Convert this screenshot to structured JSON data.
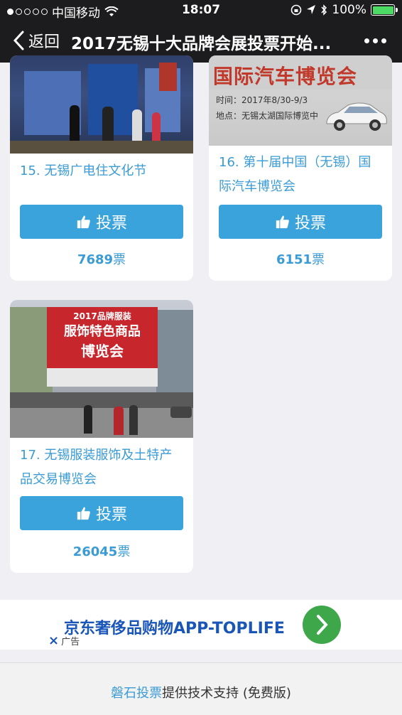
{
  "status": {
    "carrier": "中国移动",
    "time": "18:07",
    "battery": "100%",
    "battery_level": 1.0
  },
  "nav": {
    "back_label": "返回",
    "title": "2017无锡十大品牌会展投票开始..."
  },
  "cards": [
    {
      "name": "15. 无锡广电住文化节",
      "vote_label": "投票",
      "count": "7689",
      "unit": "票"
    },
    {
      "name": "16. 第十届中国（无锡）国际汽车博览会",
      "vote_label": "投票",
      "count": "6151",
      "unit": "票",
      "poster": {
        "headline": "国际汽车博览会",
        "line1": "时间：2017年8/30-9/3",
        "line2": "地点：无锡太湖国际博览中"
      }
    },
    {
      "name": "17. 无锡服装服饰及土特产品交易博览会",
      "vote_label": "投票",
      "count": "26045",
      "unit": "票",
      "banner": {
        "l1": "2017品牌服装",
        "l2": "服饰特色商品",
        "l3": "博览会"
      }
    }
  ],
  "ad": {
    "text": "京东奢侈品购物APP-TOPLIFE",
    "label": "广告",
    "close_symbol": "×"
  },
  "footer": {
    "brand": "磐石投票",
    "text": "提供技术支持 (免费版)"
  },
  "colors": {
    "accent": "#3aa3dc",
    "link": "#3a9bd5",
    "ad_blue": "#1a56b8",
    "ad_green": "#3ea74a"
  }
}
